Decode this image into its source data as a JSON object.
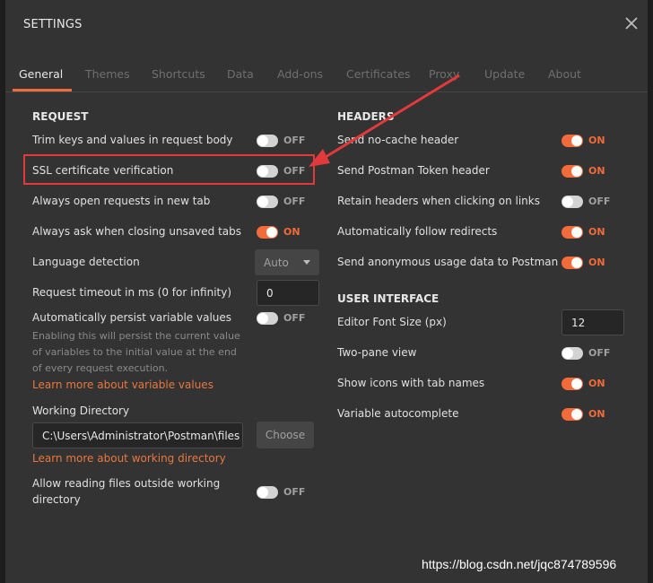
{
  "window": {
    "title": "SETTINGS",
    "close_icon": "close-icon"
  },
  "tabs": [
    {
      "label": "General",
      "active": true
    },
    {
      "label": "Themes"
    },
    {
      "label": "Shortcuts"
    },
    {
      "label": "Data"
    },
    {
      "label": "Add-ons"
    },
    {
      "label": "Certificates"
    },
    {
      "label": "Proxy"
    },
    {
      "label": "Update"
    },
    {
      "label": "About"
    }
  ],
  "request": {
    "title": "REQUEST",
    "trim": {
      "label": "Trim keys and values in request body",
      "state": "OFF"
    },
    "ssl": {
      "label": "SSL certificate verification",
      "state": "OFF"
    },
    "new_tab": {
      "label": "Always open requests in new tab",
      "state": "OFF"
    },
    "ask_close": {
      "label": "Always ask when closing unsaved tabs",
      "state": "ON"
    },
    "language": {
      "label": "Language detection",
      "value": "Auto"
    },
    "timeout": {
      "label": "Request timeout in ms (0 for infinity)",
      "value": "0"
    },
    "persist": {
      "label": "Automatically persist variable values",
      "state": "OFF",
      "help": "Enabling this will persist the current value of variables to the initial value at the end of every request execution.",
      "link": "Learn more about variable values"
    },
    "workdir": {
      "label": "Working Directory",
      "value": "C:\\Users\\Administrator\\Postman\\files",
      "button": "Choose",
      "link": "Learn more about working directory"
    },
    "outside": {
      "label_line1": "Allow reading files outside working",
      "label_line2": "directory",
      "state": "OFF"
    }
  },
  "headers": {
    "title": "HEADERS",
    "nocache": {
      "label": "Send no-cache header",
      "state": "ON"
    },
    "token": {
      "label": "Send Postman Token header",
      "state": "ON"
    },
    "retain": {
      "label": "Retain headers when clicking on links",
      "state": "OFF"
    },
    "redirects": {
      "label": "Automatically follow redirects",
      "state": "ON"
    },
    "usage": {
      "label": "Send anonymous usage data to Postman",
      "state": "ON"
    }
  },
  "ui": {
    "title": "USER INTERFACE",
    "font_size": {
      "label": "Editor Font Size (px)",
      "value": "12"
    },
    "two_pane": {
      "label": "Two-pane view",
      "state": "OFF"
    },
    "show_icons": {
      "label": "Show icons with tab names",
      "state": "ON"
    },
    "autocomplete": {
      "label": "Variable autocomplete",
      "state": "ON"
    }
  },
  "watermark": "https://blog.csdn.net/jqc874789596",
  "colors": {
    "accent": "#f26b3a",
    "annotation": "#e23a3a",
    "background": "#333333"
  }
}
